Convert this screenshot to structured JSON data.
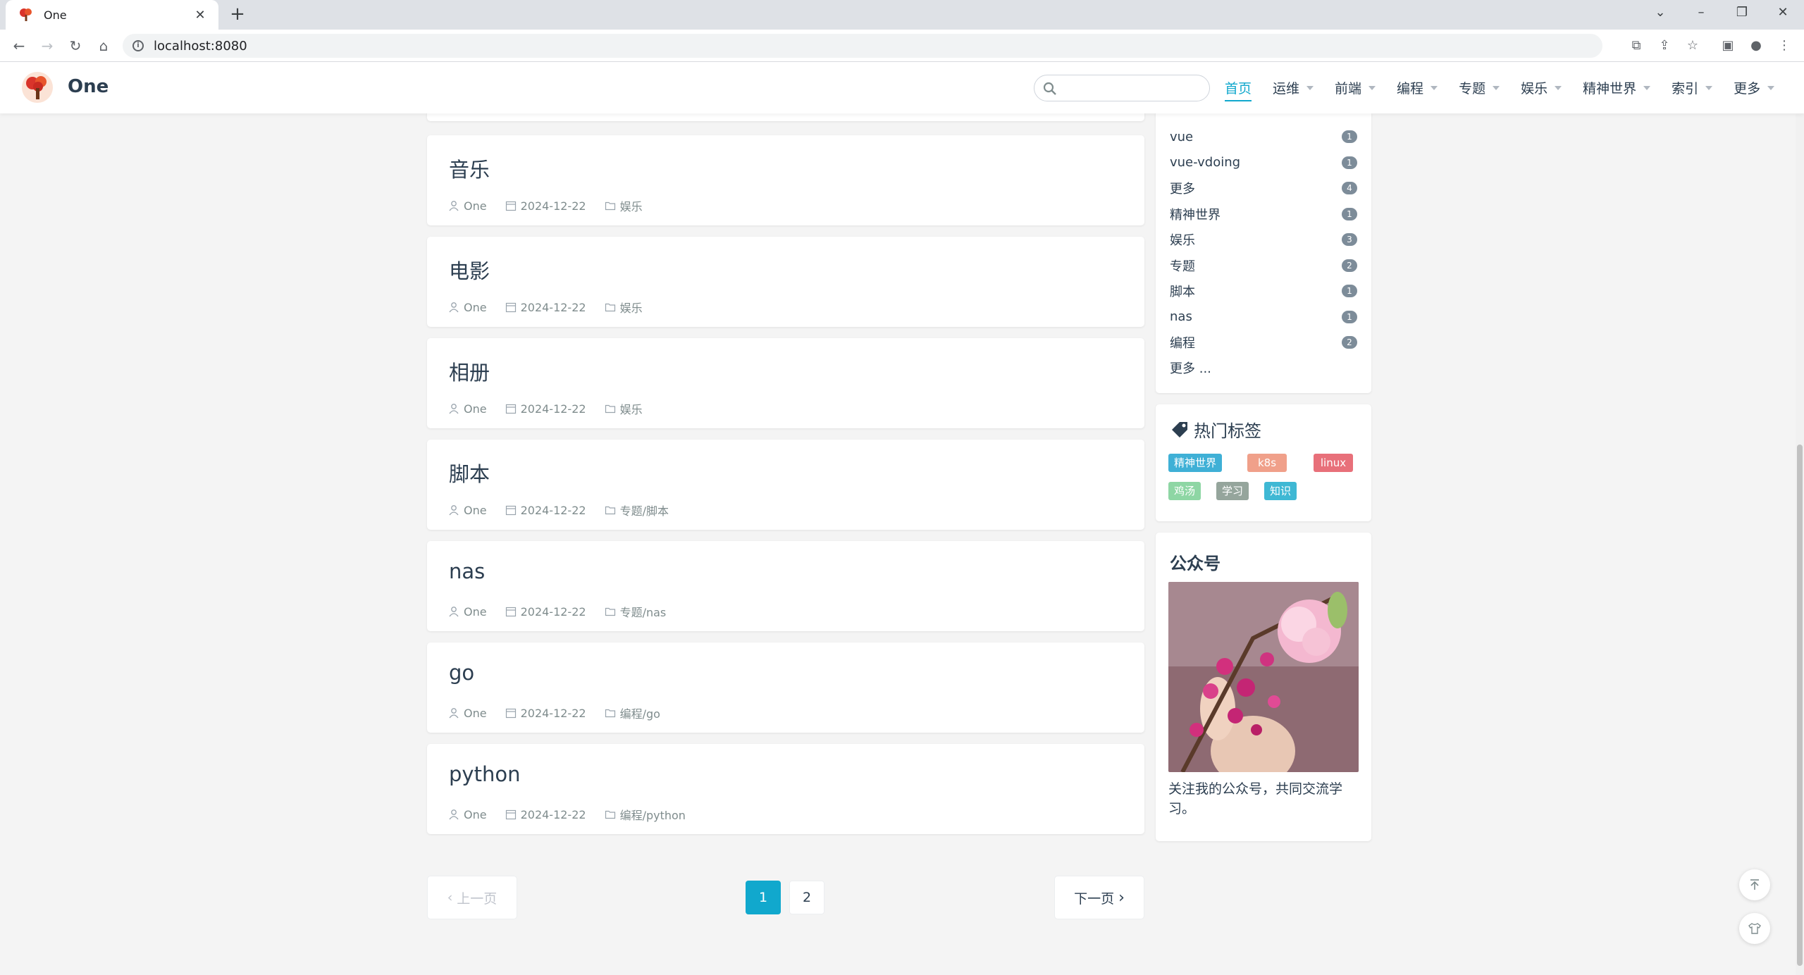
{
  "browser": {
    "tab_title": "One",
    "url": "localhost:8080"
  },
  "site": {
    "title": "One",
    "search_placeholder": "",
    "nav": [
      {
        "label": "首页",
        "active": true,
        "dropdown": false
      },
      {
        "label": "运维",
        "active": false,
        "dropdown": true
      },
      {
        "label": "前端",
        "active": false,
        "dropdown": true
      },
      {
        "label": "编程",
        "active": false,
        "dropdown": true
      },
      {
        "label": "专题",
        "active": false,
        "dropdown": true
      },
      {
        "label": "娱乐",
        "active": false,
        "dropdown": true
      },
      {
        "label": "精神世界",
        "active": false,
        "dropdown": true
      },
      {
        "label": "索引",
        "active": false,
        "dropdown": true
      },
      {
        "label": "更多",
        "active": false,
        "dropdown": true
      }
    ]
  },
  "posts": [
    {
      "title": "音乐",
      "author": "One",
      "date": "2024-12-22",
      "category": "娱乐"
    },
    {
      "title": "电影",
      "author": "One",
      "date": "2024-12-22",
      "category": "娱乐"
    },
    {
      "title": "相册",
      "author": "One",
      "date": "2024-12-22",
      "category": "娱乐"
    },
    {
      "title": "脚本",
      "author": "One",
      "date": "2024-12-22",
      "category": "专题/脚本"
    },
    {
      "title": "nas",
      "author": "One",
      "date": "2024-12-22",
      "category": "专题/nas"
    },
    {
      "title": "go",
      "author": "One",
      "date": "2024-12-22",
      "category": "编程/go"
    },
    {
      "title": "python",
      "author": "One",
      "date": "2024-12-22",
      "category": "编程/python"
    }
  ],
  "categories": {
    "items": [
      {
        "name": "vue",
        "count": "1"
      },
      {
        "name": "vue-vdoing",
        "count": "1"
      },
      {
        "name": "更多",
        "count": "4"
      },
      {
        "name": "精神世界",
        "count": "1"
      },
      {
        "name": "娱乐",
        "count": "3"
      },
      {
        "name": "专题",
        "count": "2"
      },
      {
        "name": "脚本",
        "count": "1"
      },
      {
        "name": "nas",
        "count": "1"
      },
      {
        "name": "编程",
        "count": "2"
      }
    ],
    "more_label": "更多 ..."
  },
  "hot_tags": {
    "title": "热门标签",
    "tags": [
      {
        "label": "精神世界",
        "color": "#3fb0d6"
      },
      {
        "label": "k8s",
        "color": "#f0a08a"
      },
      {
        "label": "linux",
        "color": "#e8707a"
      },
      {
        "label": "鸡汤",
        "color": "#8ed6a4"
      },
      {
        "label": "学习",
        "color": "#95a59c"
      },
      {
        "label": "知识",
        "color": "#3fb8d4"
      }
    ]
  },
  "wechat": {
    "title": "公众号",
    "caption": "关注我的公众号，共同交流学习。"
  },
  "pagination": {
    "prev_label": "上一页",
    "next_label": "下一页",
    "pages": [
      "1",
      "2"
    ],
    "current": "1"
  },
  "colors": {
    "accent": "#11a8cd",
    "text": "#2c3e50",
    "meta": "#7f8c8d",
    "background": "#f4f4f4"
  }
}
